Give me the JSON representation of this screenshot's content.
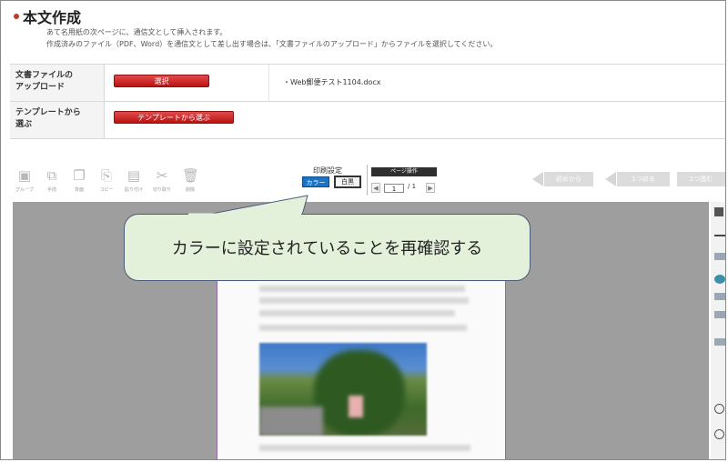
{
  "header": {
    "title": "本文作成",
    "desc_line1": "あて名用紙の次ページに、通信文として挿入されます。",
    "desc_line2": "作成済みのファイル（PDF、Word）を通信文として差し出す場合は、「文書ファイルのアップロード」からファイルを選択してください。"
  },
  "upload": {
    "row1_label_a": "文書ファイルの",
    "row1_label_b": "アップロード",
    "select_button": "選択",
    "filename": "・Web郵便テスト1104.docx",
    "row2_label_a": "テンプレートから",
    "row2_label_b": "選ぶ",
    "template_button": "テンプレートから選ぶ"
  },
  "toolbar": {
    "tools": [
      "グループ",
      "手前",
      "背面",
      "コピー",
      "貼り付け",
      "切り取り",
      "削除"
    ],
    "print_setting": "印刷設定",
    "color_button": "カラー",
    "bw_button": "白黒",
    "page_ops": "ページ操作",
    "page_current": "1",
    "page_total": "/ 1",
    "nav_first": "初めから",
    "nav_back": "1つ戻る",
    "nav_forward": "1つ進む"
  },
  "callout": {
    "text": "カラーに設定されていることを再確認する"
  },
  "colors": {
    "accent_red": "#c81d1d",
    "color_button_blue": "#1b73c4",
    "callout_fill": "#e3f0da",
    "canvas_gray": "#9e9e9e"
  },
  "icons": [
    "group-icon",
    "bring-forward-icon",
    "send-backward-icon",
    "copy-icon",
    "paste-icon",
    "cut-icon",
    "trash-icon"
  ]
}
